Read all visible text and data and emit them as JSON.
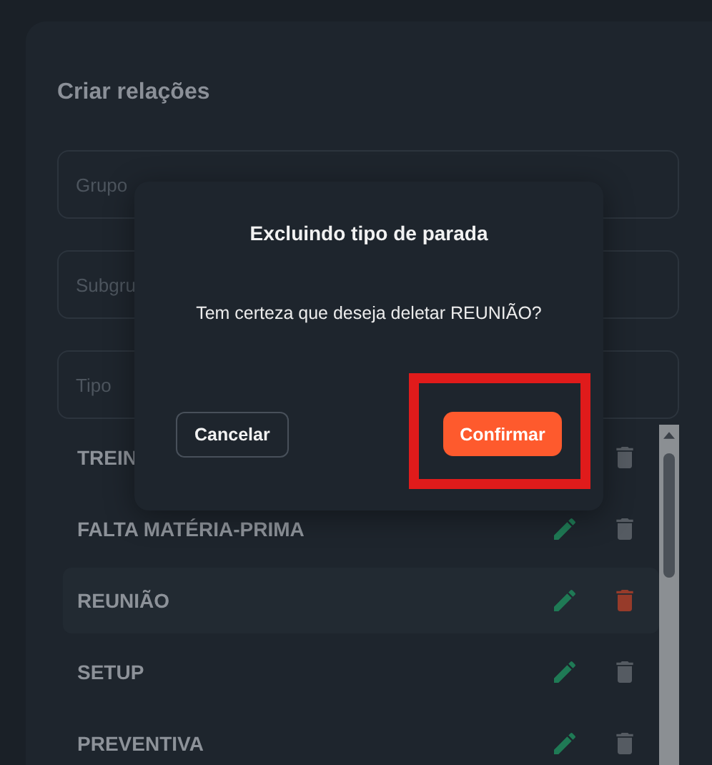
{
  "card": {
    "title": "Criar relações"
  },
  "fields": [
    {
      "placeholder": "Grupo"
    },
    {
      "placeholder": "Subgru"
    },
    {
      "placeholder": "Tipo"
    }
  ],
  "rows": [
    {
      "name": "TREIN",
      "selected": false
    },
    {
      "name": "FALTA MATÉRIA-PRIMA",
      "selected": false
    },
    {
      "name": "REUNIÃO",
      "selected": true
    },
    {
      "name": "SETUP",
      "selected": false
    },
    {
      "name": "PREVENTIVA",
      "selected": false
    }
  ],
  "dialog": {
    "title": "Excluindo tipo de parada",
    "message": "Tem certeza que deseja deletar REUNIÃO?",
    "cancel": "Cancelar",
    "confirm": "Confirmar",
    "highlight": {
      "kind": "box",
      "color": "#e01b1b"
    }
  }
}
